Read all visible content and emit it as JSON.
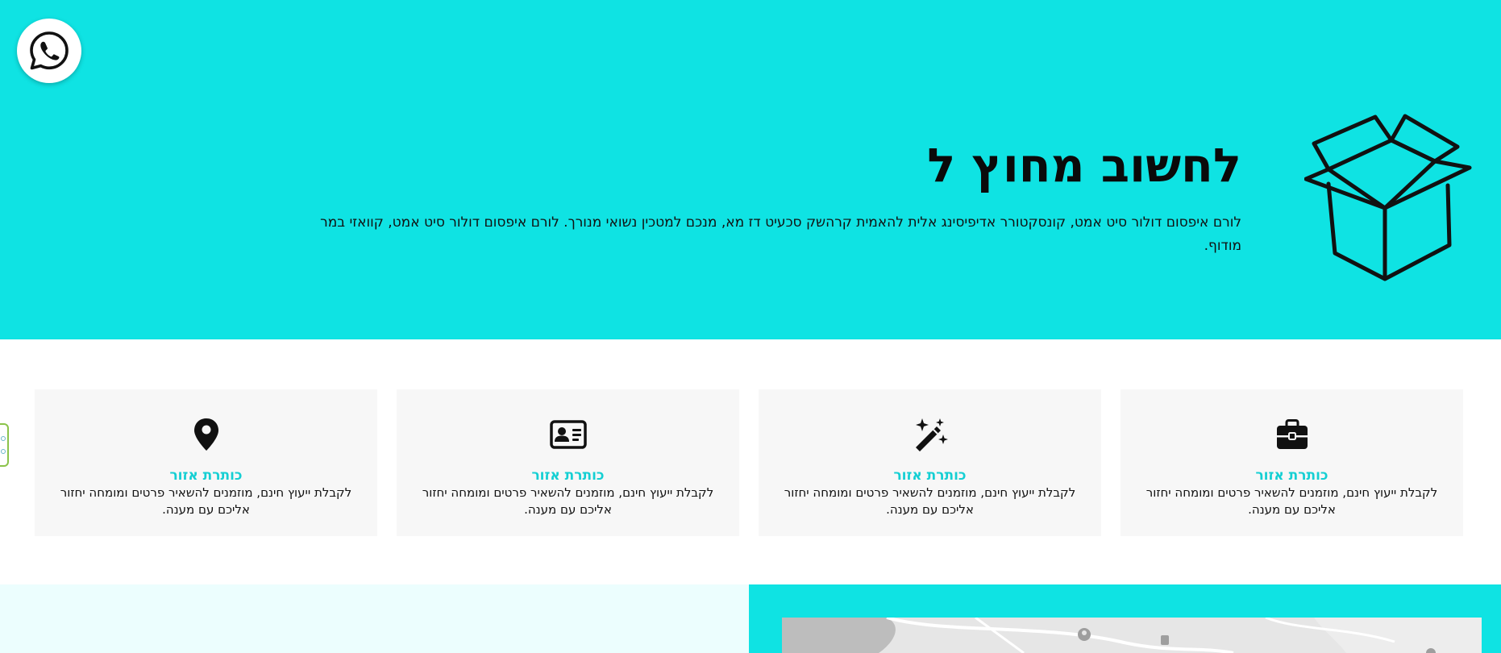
{
  "hero": {
    "title": "לחשוב מחוץ ל",
    "text": "לורם איפסום דולור סיט אמט, קונסקטורר אדיפיסינג אלית להאמית קרהשק סכעיט דז מא, מנכם למטכין נשואי מנורך. לורם איפסום דולור סיט אמט, קוואזי במר מודוף."
  },
  "features": [
    {
      "icon": "briefcase-icon",
      "title": "כותרת אזור",
      "text": "לקבלת ייעוץ חינם, מוזמנים להשאיר פרטים ומומחה יחזור אליכם עם מענה."
    },
    {
      "icon": "magic-wand-icon",
      "title": "כותרת אזור",
      "text": "לקבלת ייעוץ חינם, מוזמנים להשאיר פרטים ומומחה יחזור אליכם עם מענה."
    },
    {
      "icon": "id-card-icon",
      "title": "כותרת אזור",
      "text": "לקבלת ייעוץ חינם, מוזמנים להשאיר פרטים ומומחה יחזור אליכם עם מענה."
    },
    {
      "icon": "location-pin-icon",
      "title": "כותרת אזור",
      "text": "לקבלת ייעוץ חינם, מוזמנים להשאיר פרטים ומומחה יחזור אליכם עם מענה."
    }
  ],
  "colors": {
    "accent": "#0fe3e3",
    "card_title": "#15cfd3",
    "card_bg": "#f7f7f7",
    "light_section": "#ecfefe"
  }
}
